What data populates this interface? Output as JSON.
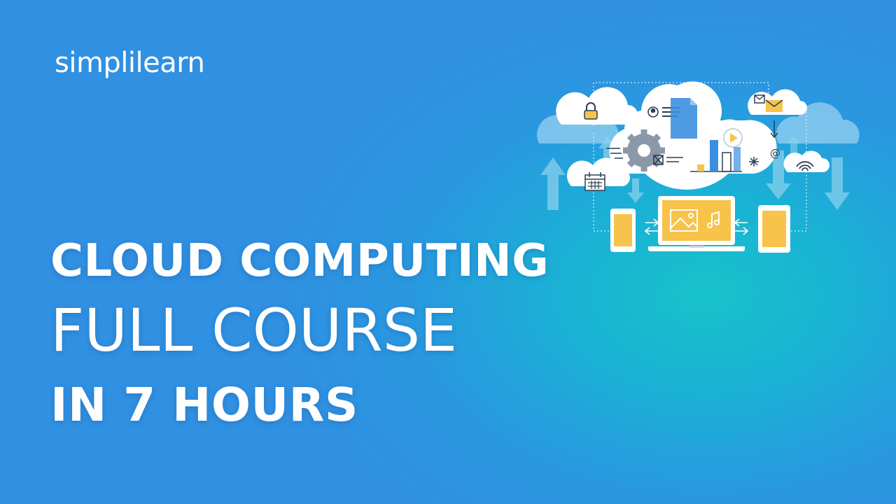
{
  "brand": {
    "logo_text": "simplilearn"
  },
  "headline": {
    "line1": "CLOUD COMPUTING",
    "line2": "FULL COURSE",
    "line3": "IN 7 HOURS"
  },
  "colors": {
    "background": "#3090e2",
    "accent_teal": "#17c3c9",
    "device_yellow": "#f7c34a",
    "cloud_white": "#ffffff",
    "doc_blue": "#3b8fe0"
  },
  "icons": [
    "lock-icon",
    "user-icon",
    "document-icon",
    "gear-icon",
    "play-icon",
    "bar-chart-icon",
    "mail-icon",
    "at-icon",
    "wifi-icon",
    "calendar-icon",
    "phone-icon",
    "laptop-icon",
    "image-icon",
    "music-icon",
    "tablet-icon",
    "upload-arrow-icon",
    "download-arrow-icon"
  ]
}
